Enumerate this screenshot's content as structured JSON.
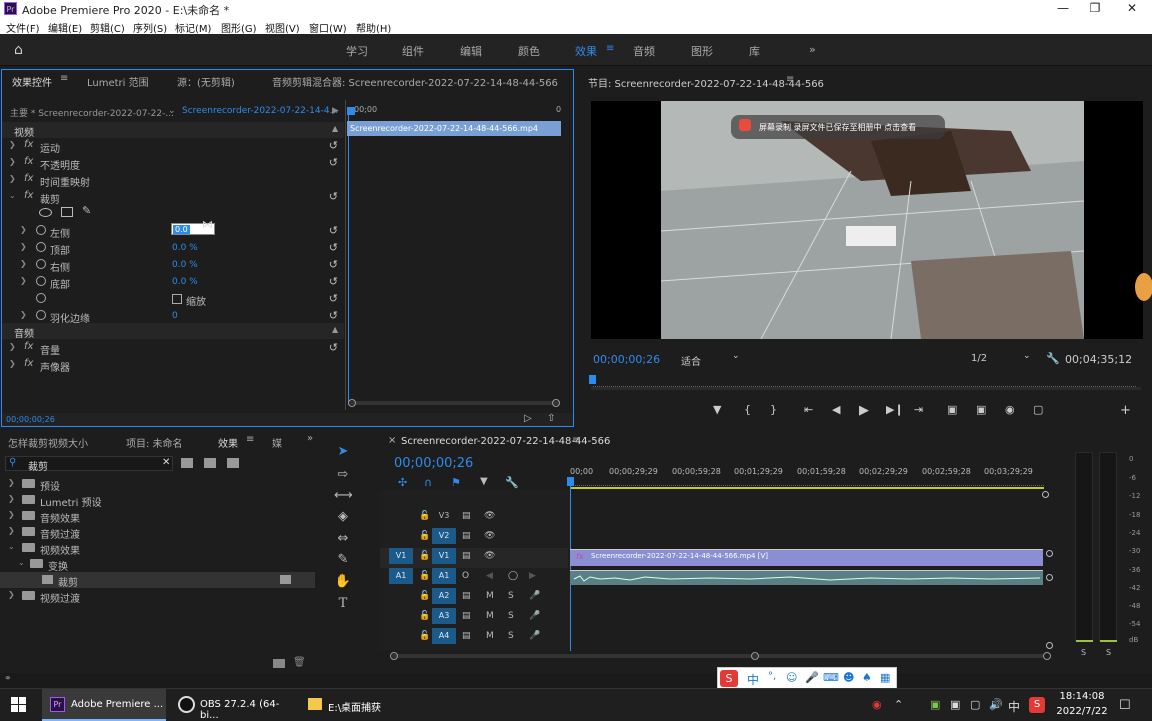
{
  "window": {
    "title": "Adobe Premiere Pro 2020 - E:\\未命名 *",
    "logo": "Pr"
  },
  "menu": [
    "文件(F)",
    "编辑(E)",
    "剪辑(C)",
    "序列(S)",
    "标记(M)",
    "图形(G)",
    "视图(V)",
    "窗口(W)",
    "帮助(H)"
  ],
  "workspaces": [
    "学习",
    "组件",
    "编辑",
    "颜色",
    "效果",
    "音频",
    "图形",
    "库"
  ],
  "active_workspace": "效果",
  "effect_controls": {
    "tabs": [
      "效果控件",
      "Lumetri 范围",
      "源：(无剪辑)",
      "音频剪辑混合器: Screenrecorder-2022-07-22-14-48-44-566"
    ],
    "master": "主要 * Screenrecorder-2022-07-22-...",
    "sequence": "Screenrecorder-2022-07-22-14-4...",
    "ruler_start": "00;00",
    "ruler_end": "0",
    "clip_name": "Screenrecorder-2022-07-22-14-48-44-566.mp4",
    "section_video": "视频",
    "section_audio": "音频",
    "effects": [
      "运动",
      "不透明度",
      "时间重映射",
      "裁剪"
    ],
    "crop_params": [
      {
        "label": "左侧",
        "value": "0.0"
      },
      {
        "label": "顶部",
        "value": "0.0 %"
      },
      {
        "label": "右侧",
        "value": "0.0 %"
      },
      {
        "label": "底部",
        "value": "0.0 %"
      }
    ],
    "zoom_label": "缩放",
    "feather_label": "羽化边缘",
    "feather_value": "0",
    "audio_effects": [
      "音量",
      "声像器"
    ],
    "timecode": "00;00;00;26"
  },
  "program_monitor": {
    "title": "节目: Screenrecorder-2022-07-22-14-48-44-566",
    "notification": "屏幕录制   录屏文件已保存至相册中 点击查看",
    "timecode": "00;00;00;26",
    "fit": "适合",
    "resolution": "1/2",
    "duration": "00;04;35;12"
  },
  "project_panel": {
    "tabs": [
      "怎样裁剪视频大小",
      "项目: 未命名",
      "效果",
      "媒"
    ],
    "search_value": "裁剪",
    "tree": [
      {
        "label": "预设",
        "indent": 0
      },
      {
        "label": "Lumetri 预设",
        "indent": 0
      },
      {
        "label": "音频效果",
        "indent": 0
      },
      {
        "label": "音频过渡",
        "indent": 0
      },
      {
        "label": "视频效果",
        "indent": 0
      },
      {
        "label": "变换",
        "indent": 1
      },
      {
        "label": "裁剪",
        "indent": 2
      },
      {
        "label": "视频过渡",
        "indent": 0
      }
    ]
  },
  "timeline": {
    "sequence_tab": "Screenrecorder-2022-07-22-14-48-44-566",
    "timecode": "00;00;00;26",
    "ruler": [
      "00;00",
      "00;00;29;29",
      "00;00;59;28",
      "00;01;29;29",
      "00;01;59;28",
      "00;02;29;29",
      "00;02;59;28",
      "00;03;29;29"
    ],
    "video_tracks": [
      "V3",
      "V2",
      "V1"
    ],
    "audio_tracks": [
      "A1",
      "A2",
      "A3",
      "A4"
    ],
    "source_v": "V1",
    "source_a": "A1",
    "video_clip": "Screenrecorder-2022-07-22-14-48-44-566.mp4 [V]",
    "audio_letters": {
      "mute": "M",
      "solo": "S",
      "o": "O"
    }
  },
  "audio_meter": {
    "labels": [
      "0",
      "-6",
      "-12",
      "-18",
      "-24",
      "-30",
      "-36",
      "-42",
      "-48",
      "-54",
      "dB"
    ],
    "solo": [
      "S",
      "S"
    ]
  },
  "ime_bar": {
    "items": [
      "中",
      "°,"
    ]
  },
  "taskbar": {
    "apps": [
      "Adobe Premiere ...",
      "OBS 27.2.4 (64-bi...",
      "E:\\桌面捕获"
    ],
    "ime": "中",
    "time": "18:14:08",
    "date": "2022/7/22"
  }
}
